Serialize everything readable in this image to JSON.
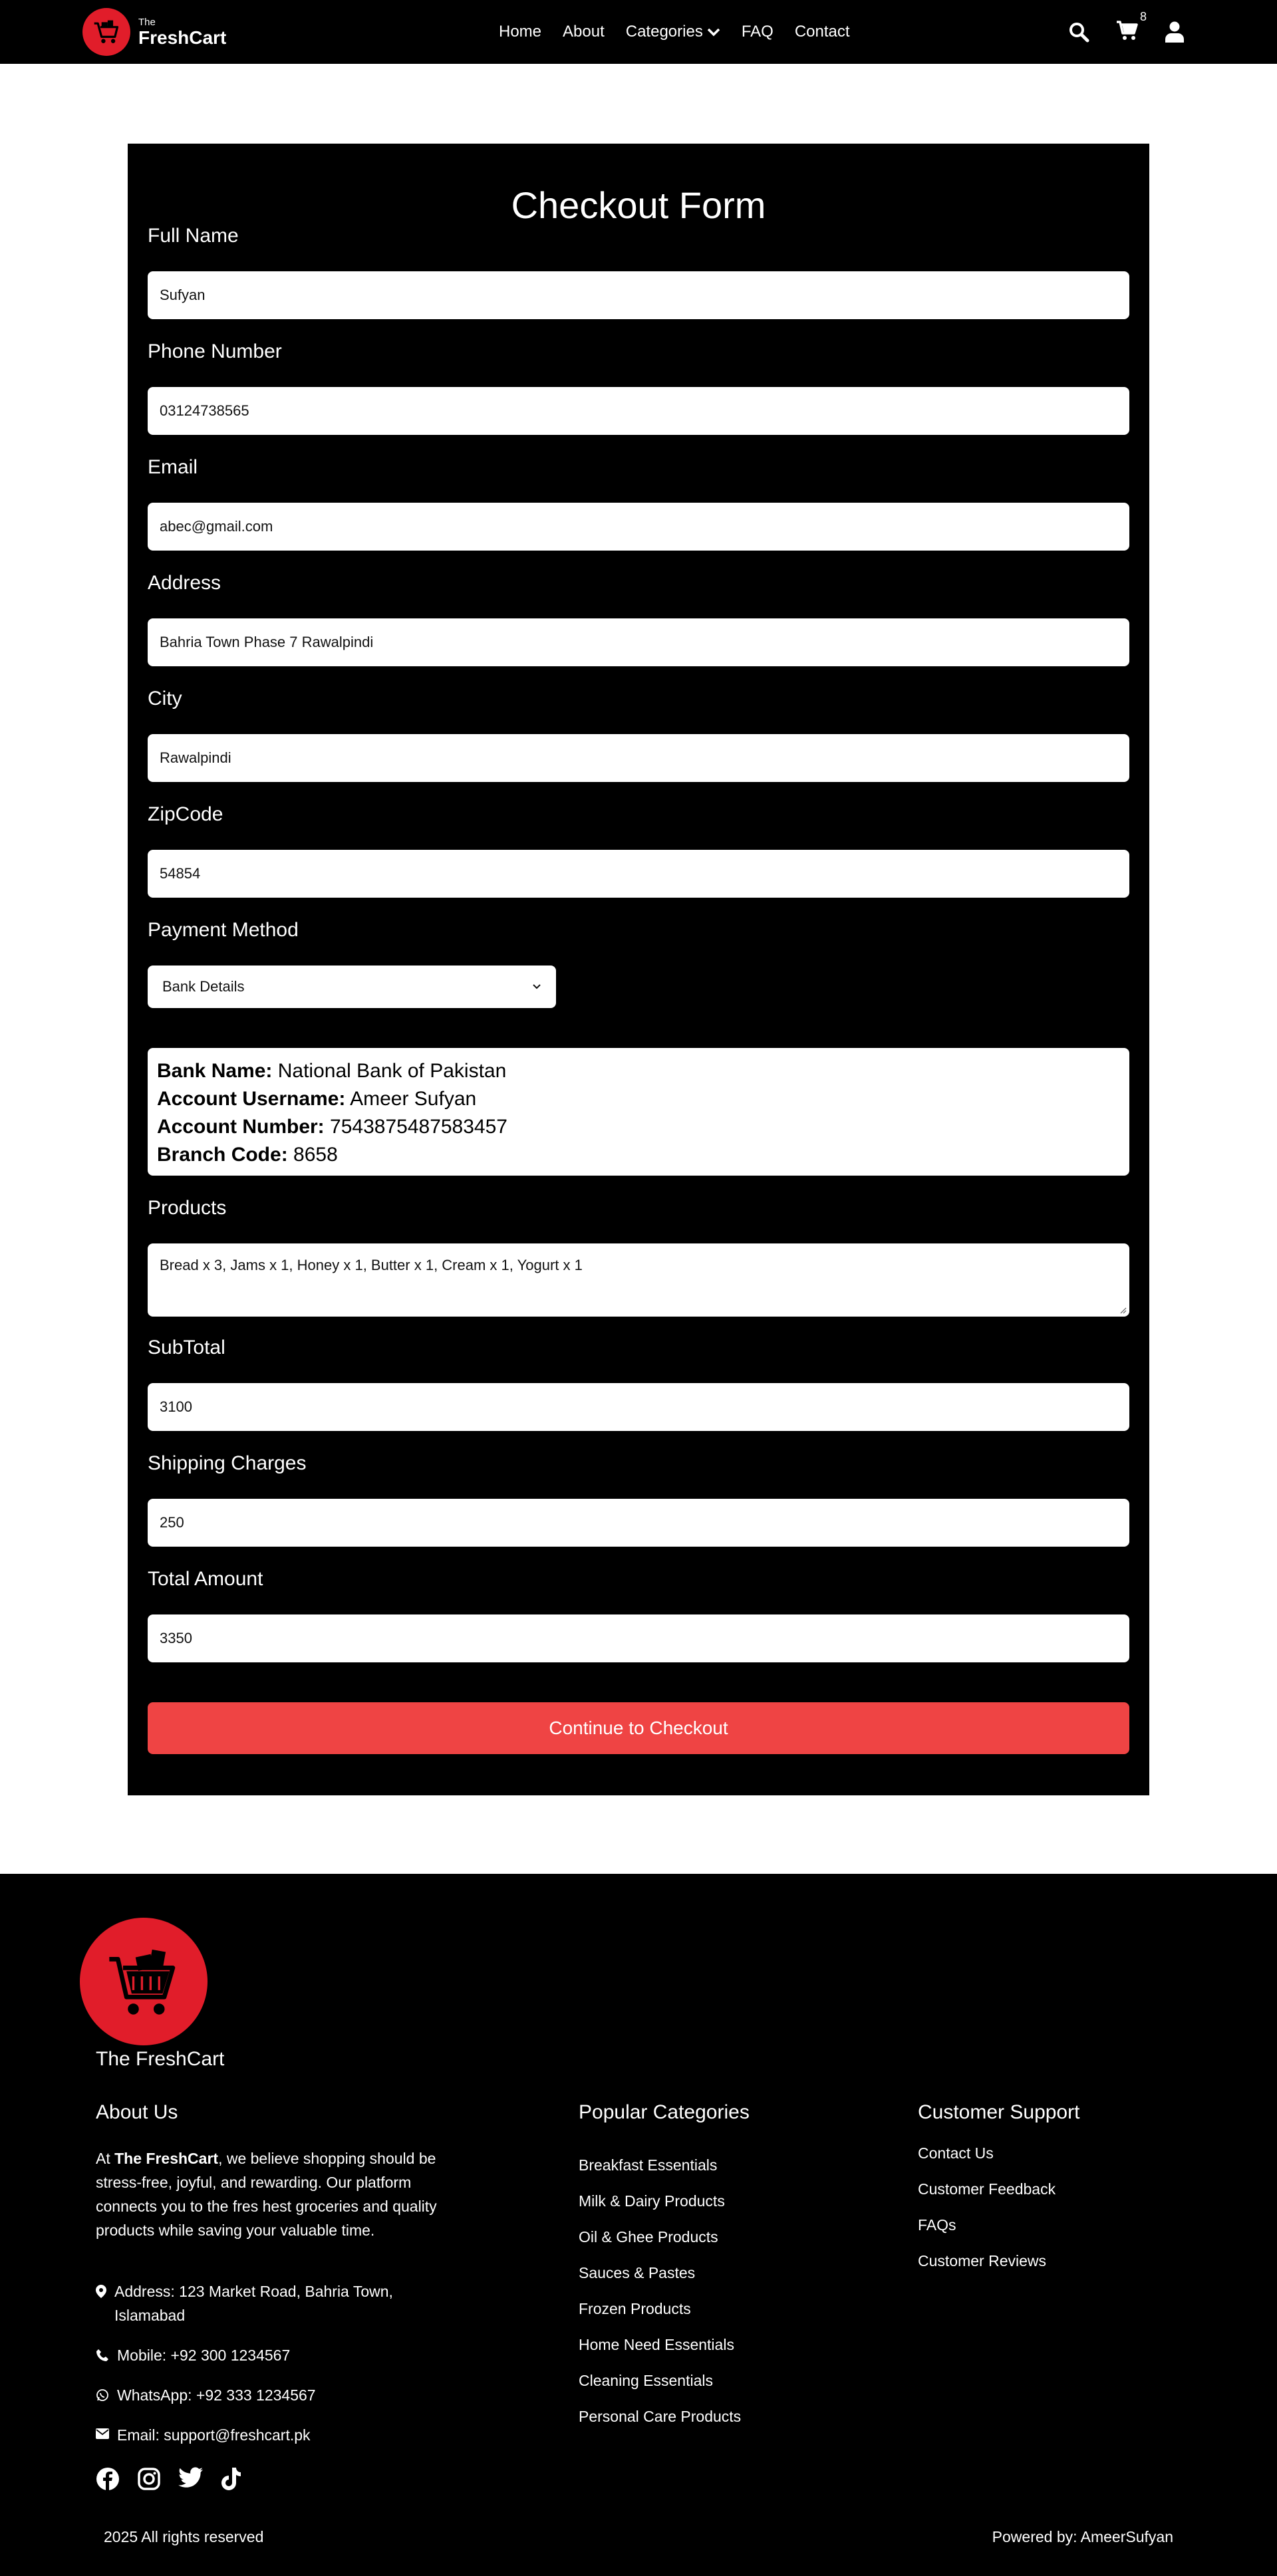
{
  "nav": {
    "brand_the": "The",
    "brand_name": "FreshCart",
    "links": [
      "Home",
      "About",
      "Categories",
      "FAQ",
      "Contact"
    ],
    "cart_count": "8",
    "brand_color": "#e11d2a"
  },
  "form": {
    "title": "Checkout Form",
    "full_name_label": "Full Name",
    "full_name_value": "Sufyan",
    "phone_label": "Phone Number",
    "phone_value": "03124738565",
    "email_label": "Email",
    "email_value": "abec@gmail.com",
    "address_label": "Address",
    "address_value": "Bahria Town Phase 7 Rawalpindi",
    "city_label": "City",
    "city_value": "Rawalpindi",
    "zip_label": "ZipCode",
    "zip_value": "54854",
    "payment_label": "Payment Method",
    "payment_selected": "Bank Details",
    "bank": {
      "bank_name_key": "Bank Name:",
      "bank_name_val": "National Bank of Pakistan",
      "username_key": "Account Username:",
      "username_val": "Ameer Sufyan",
      "number_key": "Account Number:",
      "number_val": "7543875487583457",
      "branch_key": "Branch Code:",
      "branch_val": "8658"
    },
    "products_label": "Products",
    "products_value": "Bread x 3, Jams x 1, Honey x 1, Butter x 1, Cream x 1, Yogurt x 1",
    "subtotal_label": "SubTotal",
    "subtotal_value": "3100",
    "shipping_label": "Shipping Charges",
    "shipping_value": "250",
    "total_label": "Total Amount",
    "total_value": "3350",
    "checkout_button": "Continue to Checkout",
    "button_color": "#ef4444"
  },
  "footer": {
    "brand": "The FreshCart",
    "about_title": "About Us",
    "about_prefix": "At ",
    "about_bold": "The FreshCart",
    "about_rest": ", we believe shopping should be stress-free, joyful, and rewarding. Our platform connects you to the fres hest groceries and quality products while saving your valuable time.",
    "address": "Address: 123 Market Road, Bahria Town, Islamabad",
    "mobile": "Mobile: +92 300 1234567",
    "whatsapp": "WhatsApp: +92 333 1234567",
    "email": "Email: support@freshcart.pk",
    "categories_title": "Popular Categories",
    "categories": [
      "Breakfast Essentials",
      "Milk & Dairy Products",
      "Oil & Ghee Products",
      "Sauces & Pastes",
      "Frozen Products",
      "Home Need Essentials",
      "Cleaning Essentials",
      "Personal Care Products"
    ],
    "support_title": "Customer Support",
    "support_links": [
      "Contact Us",
      "Customer Feedback",
      "FAQs",
      "Customer Reviews"
    ],
    "socials": [
      "facebook-icon",
      "instagram-icon",
      "twitter-icon",
      "tiktok-icon"
    ],
    "copyright": "2025 All rights reserved",
    "powered": "Powered by: AmeerSufyan"
  }
}
